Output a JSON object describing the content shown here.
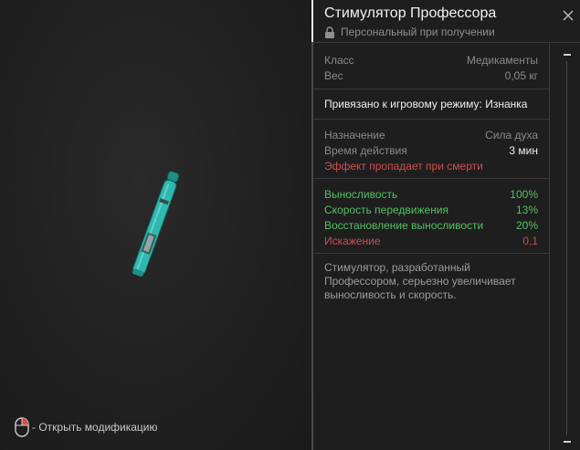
{
  "item": {
    "title": "Стимулятор Профессора",
    "binding": "Персональный при получении"
  },
  "basic": [
    {
      "label": "Класс",
      "value": "Медикаменты"
    },
    {
      "label": "Вес",
      "value": "0,05 кг"
    }
  ],
  "mode_binding": "Привязано к игровому режиму: Изнанка",
  "usage": [
    {
      "label": "Назначение",
      "value": "Сила духа"
    },
    {
      "label": "Время действия",
      "value": "3 мин"
    }
  ],
  "death_warning": "Эффект пропадает при смерти",
  "stats": [
    {
      "label": "Выносливость",
      "value": "100%"
    },
    {
      "label": "Скорость передвижения",
      "value": "13%"
    },
    {
      "label": "Восстановление выносливости",
      "value": "20%"
    },
    {
      "label": "Искажение",
      "value": "0,1"
    }
  ],
  "description": "Стимулятор, разработанный\nПрофессором, серьезно увеличивает\nвыносливость и скорость.",
  "hint": {
    "text": "- Открыть модификацию",
    "icon": "mouse-right-click-icon"
  },
  "colors": {
    "positive": "#54c062",
    "negative": "#d04e4e",
    "item_teal": "#2fb8b0"
  }
}
